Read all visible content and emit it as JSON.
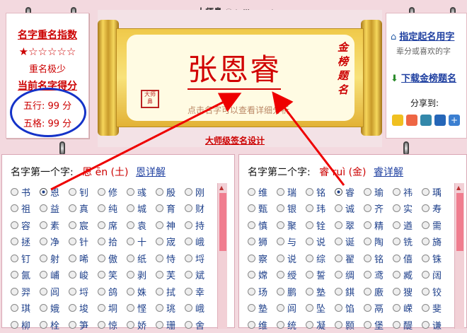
{
  "site": {
    "logo_cn": "大师鼻",
    "logo_yin": "☯",
    "domain": "taijiyu.net"
  },
  "left_card": {
    "title1": "名字重名指数",
    "stars": "★☆☆☆☆☆",
    "dup_text": "重名极少",
    "title2": "当前名字得分",
    "wuxing": "五行: 99 分",
    "wuge": "五格: 99 分"
  },
  "scroll": {
    "name": "张恩睿",
    "hint": "点击名字可以查看详细分析",
    "side_text": "金榜题名",
    "seal": "大师\n鼻",
    "footer": "大师级签名设计"
  },
  "right_card": {
    "link1": "指定起名用字",
    "desc1": "辈分或喜欢的字",
    "link2": "下载金榜题名",
    "share_label": "分享到:"
  },
  "panel1": {
    "label": "名字第一个字:",
    "char": "恩",
    "pinyin": "ēn (土)",
    "detail": "恩详解",
    "rows": [
      [
        "书",
        "恩",
        "钊",
        "修",
        "彧",
        "殷",
        "刚"
      ],
      [
        "祖",
        "益",
        "真",
        "纯",
        "城",
        "育",
        "财"
      ],
      [
        "容",
        "素",
        "宸",
        "席",
        "袁",
        "神",
        "持"
      ],
      [
        "拯",
        "净",
        "针",
        "拾",
        "十",
        "宬",
        "峨"
      ],
      [
        "钉",
        "射",
        "唏",
        "傲",
        "纸",
        "恃",
        "埒"
      ],
      [
        "氤",
        "峬",
        "峻",
        "笑",
        "剥",
        "芙",
        "斌"
      ],
      [
        "羿",
        "闾",
        "埒",
        "鸽",
        "姝",
        "拭",
        "幸"
      ],
      [
        "琪",
        "娥",
        "埈",
        "垌",
        "悭",
        "珧",
        "峨"
      ],
      [
        "柳",
        "栓",
        "笋",
        "惊",
        "娇",
        "珊",
        "舍"
      ]
    ],
    "selected_index": 1
  },
  "panel2": {
    "label": "名字第二个字:",
    "char": "睿",
    "pinyin": "ruì (金)",
    "detail": "睿详解",
    "rows": [
      [
        "维",
        "瑞",
        "铭",
        "睿",
        "瑜",
        "祎",
        "瑀"
      ],
      [
        "甄",
        "银",
        "玮",
        "诚",
        "齐",
        "实",
        "寿"
      ],
      [
        "慎",
        "聚",
        "铨",
        "翠",
        "精",
        "遒",
        "需"
      ],
      [
        "狮",
        "与",
        "说",
        "诞",
        "陶",
        "铣",
        "旖"
      ],
      [
        "察",
        "说",
        "综",
        "翟",
        "铭",
        "僖",
        "铢"
      ],
      [
        "嫦",
        "绶",
        "誓",
        "绸",
        "鸢",
        "臧",
        "阔"
      ],
      [
        "玚",
        "鹏",
        "塾",
        "錤",
        "廒",
        "獀",
        "铰"
      ],
      [
        "塾",
        "闾",
        "坠",
        "馅",
        "鬲",
        "嵘",
        "斐"
      ],
      [
        "维",
        "统",
        "凝",
        "颢",
        "堡",
        "醍",
        "谦"
      ]
    ],
    "selected_index": 3
  },
  "colors": {
    "accent_red": "#cc0000",
    "link_blue": "#1e3fa0",
    "bg_pink": "#f3d9df"
  }
}
